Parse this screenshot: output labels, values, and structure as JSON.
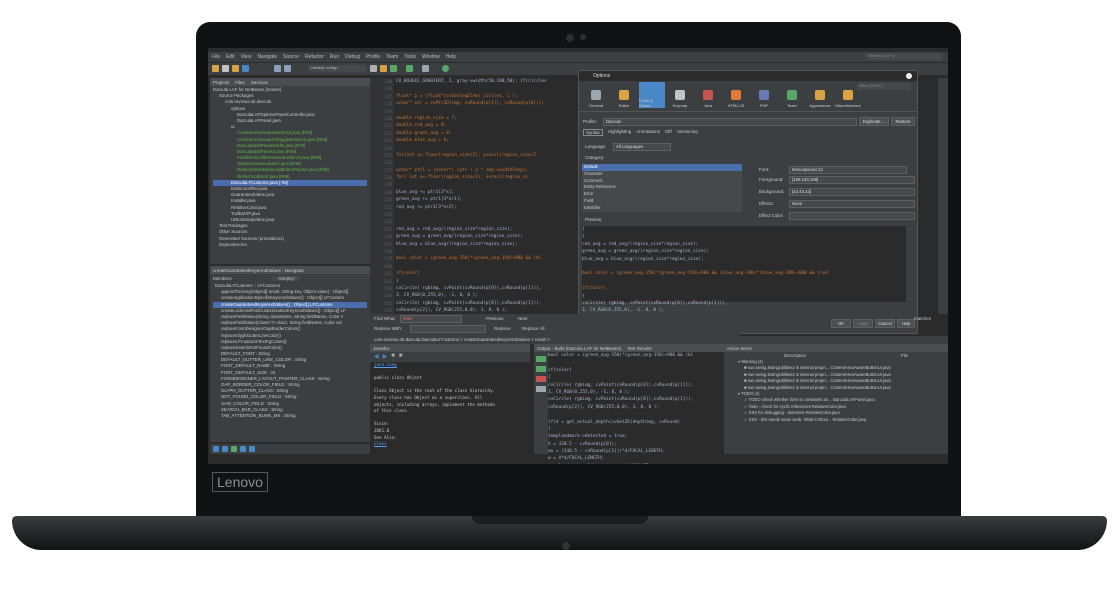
{
  "brand": "Lenovo",
  "menu": [
    "File",
    "Edit",
    "View",
    "Navigate",
    "Source",
    "Refactor",
    "Run",
    "Debug",
    "Profile",
    "Team",
    "Tools",
    "Window",
    "Help"
  ],
  "search_placeholder": "Search (Ctrl+I)",
  "config": "<default config>",
  "project_tabs": [
    "Projects",
    "Files",
    "Services"
  ],
  "tree": [
    "Darcula LAF for NetBeans [master]",
    "Source Packages",
    "com.revivius.nb.darcula",
    "options",
    "DarculaLAFOptionsPanelController.java",
    "DarculaLAFPanel.java",
    "ui",
    "ContentAreaAwareButtonUI.java [R/M]",
    "ContentAreaAwareJToggleButtonUI.java [R/M]",
    "DarculaSplitPaneDivider.java [R/M]",
    "DarculaSplitPaneUI.java [R/M]",
    "InvisibleScrollbarAwareBorderUI.java [R/M]",
    "OptionsAwareLabelUI.java [R/M]",
    "ReducedInsetsDarculaButtonPainter.java [R/M]",
    "RetinaToolbarUI.java [R/M]",
    "DarculaLFCustoms.java [-/M]",
    "DarkIconFilter.java",
    "GuaranteedValue.java",
    "Installer.java",
    "RelativeColor.java",
    "ToolbarXP.java",
    "UIBootstrapValue.java",
    "Test Packages",
    "Other Sources",
    "Generated Sources (annotations)",
    "Dependencies"
  ],
  "navigator_title": "createGuaranteedKeysAndValues - Navigator",
  "navigator_members": "Members",
  "navigator_filter": "<empty>",
  "navigator_items": [
    "DarculaLFCustoms :: LFCustoms",
    "appendToArray(Object[] result, String key, Object value) : Object[]",
    "createApplicationSpecificKeysAndValues() : Object[] LFCustom",
    "createGuaranteedKeysAndValues() : Object[] LFCustoms",
    "createLookAndFeelCustomizationKeysAndValues() : Object[] LF",
    "replaceFieldValue(String className, String fieldName, Color v",
    "replaceFieldValue(Class<?> clazz, String fieldName, Color val",
    "replaceFormDesignerGapBorderColors()",
    "replaceGlyphGutterLineColor()",
    "replaceLFCustomsTextFgColors()",
    "replaceSearchNotFoundColor()",
    "DEFAULT_FONT : String",
    "DEFAULT_GUTTER_LINE_COLOR : String",
    "FONT_DEFAULT_NAME : String",
    "FONT_DEFAULT_SIZE : int",
    "FORMDESIGNER_LAYOUT_PAINTER_CLASS : String",
    "GAP_BORDER_COLOR_FIELD : String",
    "GLYPH_GUTTER_CLASS : String",
    "NOT_FOUND_COLOR_FIELD : String",
    "SAW_COLOR_FIELD : String",
    "SEARCH_BAR_CLASS : String",
    "TAB_ATTENTION_BLINK_MS : String"
  ],
  "gutter_lines": [
    "118",
    "116",
    "117",
    "118",
    "119",
    "120",
    "121",
    "122",
    "123",
    "124",
    "125",
    "126",
    "127",
    "128",
    "129",
    "130",
    "131",
    "132",
    "133",
    "134",
    "135",
    "136",
    "137",
    "138",
    "139",
    "140",
    "141",
    "142",
    "143",
    "144",
    "145",
    "146"
  ],
  "code_lines": [
    "    CV_BOOGIE_GRADIENT, 2, gray->width/50,100,50); if(circles",
    "",
    "  float* p = (float*)cvGetSeqElem( circles, i );",
    "  uchar* ptr  = cvPtr2D(img, cvRound(p[1]), cvRound(p[0]));",
    "",
    "  double region_size = 7;",
    "  double red_avg = 0;",
    "  double green_avg = 0;",
    "  double blue_avg = 0;",
    "",
    "  for(int y=-floor(region_size/2); y<ceil(region_size/2",
    "",
    "    uchar* ptr1 = (uchar*) (ptr + y * img->widthStep);",
    "    for( int x=-floor(region_size/2); x<ceil(region_si",
    "",
    "      blue_avg += ptr1[3*x];",
    "      green_avg += ptr1[3*x+1];",
    "      red_avg += ptr1[3*x+2];",
    "",
    "",
    "  red_avg = red_avg/(region_size*region_size);",
    "  green_avg = green_avg/(region_size*region_size);",
    "  blue_avg = blue_avg/(region_size*region_size);",
    "",
    "  bool color = (green_avg-150)*(green_avg-150)<900 && (bl",
    "",
    "  if(color)",
    "  {",
    "  cvCircle( rgbimg, cvPoint(cvRound(p[0]),cvRound(p[1])),",
    "      3, CV_RGB(0,255,0), -1, 8, 0 );",
    "  cvCircle( rgbimg, cvPoint(cvRound(p[0]),cvRound(p[1])),",
    "      cvRound(p[2]), CV_RGB(255,0,0), 3, 8, 0 );"
  ],
  "options": {
    "title": "Options",
    "filter": "Filter (Ctrl+F)",
    "tabs": [
      "General",
      "Editor",
      "Fonts & Colors",
      "Keymap",
      "Java",
      "HTML/JS",
      "PHP",
      "Team",
      "Appearance",
      "Miscellaneous"
    ],
    "profile_label": "Profile:",
    "profile_value": "Darcula",
    "duplicate": "Duplicate ...",
    "restore": "Restore",
    "subtabs": [
      "Syntax",
      "Highlighting",
      "Annotations",
      "Diff",
      "Versioning"
    ],
    "language_label": "Language:",
    "language_value": "All Languages",
    "category_label": "Category:",
    "categories": [
      "Default",
      "Character",
      "Comment",
      "Entity Reference",
      "Error",
      "Field",
      "Identifier"
    ],
    "font_label": "Font:",
    "font_value": "Monospaced 13",
    "fg_label": "Foreground:",
    "fg_value": "[169,183,198]",
    "bg_label": "Background:",
    "bg_value": "[43,43,43]",
    "effects_label": "Effects:",
    "effects_value": "None",
    "effect_color_label": "Effect Color:",
    "preview_label": "Preview:",
    "preview_lines": [
      "    }",
      "}",
      "red_avg = red_avg/(region_size*region_size);",
      "green_avg = green_avg/(region_size*region_size);",
      "blue_avg = blue_avg/(region_size*region_size);",
      "",
      "bool color = (green_avg-150)*(green_avg-150)<900 && (blue_avg-100)*(blue_avg-100)<600 && (red",
      "",
      "if(color)",
      "{",
      "cvCircle( rgbimg, cvPoint(cvRound(p[0]),cvRound(p[1])),",
      "    3, CV_RGB(0,255,0), -1, 8, 0 );",
      "  cvCircle( rgbimg, cvPoint(cvRound(p[0]),cvRound(p[1])),"
    ],
    "export": "Export...",
    "import": "Import...",
    "ok": "OK",
    "apply": "Apply",
    "cancel": "Cancel",
    "help": "Help"
  },
  "find": {
    "find_label": "Find What:",
    "find_value": "5008",
    "replace_label": "Replace With:",
    "previous": "Previous",
    "next": "Next",
    "replace": "Replace",
    "replace_all": "Replace All",
    "matches": "matches"
  },
  "breadcrumb": "com.revivius.nb.darcula.DarculaLFCustoms  >  createGuaranteedKeysAndValues  >  result  >",
  "javadoc": {
    "title": "Javadoc",
    "lines": [
      "java.lang",
      "",
      "public class Object",
      "",
      "Class Object is the root of the class hierarchy.",
      "Every class has Object as a superclass. All",
      "objects, including arrays, implement the methods",
      "of this class.",
      "",
      "Since:",
      "  JDK1.0",
      "See Also:",
      "  Class"
    ]
  },
  "output": {
    "title": "Output - Build (Darcula LAF for NetBeans)",
    "test_title": "Test Results",
    "lines": [
      "bool color = (green_avg-150)*(green_avg-150)<900 && (bl",
      "",
      "if(color)",
      "{",
      "cvCircle( rgbimg, cvPoint(cvRound(p[0]),cvRound(p[1])),",
      "    3, CV_RGB(0,255,0), -1, 8, 0 );",
      "  cvCircle( rgbimg, cvPoint(cvRound(p[0]),cvRound(p[1])),",
      "      cvRound(p[2]), CV_RGB(255,0,0), 3, 8, 0 );",
      "",
      "  if(d = get_actual_depth(cvGet2D(depthimg, cvRound(",
      "  {",
      "    templandmark->detected = true;",
      "    X   = 320.5 - cvRound(p[0]);",
      "    mu  = (240.5 - cvRound(p[1]))*d/FOCAL_LENGTH;",
      "    w  = X*d/FOCAL_LENGTH;",
      "    templandmark->alpha = atan(w/d)*180/PI;"
    ]
  },
  "action_items": {
    "title": "Action Items",
    "col_description": "Description",
    "col_file": "File",
    "warning_header": "Warning (4)",
    "warnings": [
      "sun.swing.SwingUtilities2 is internal propri...  ContentAreaAwareButtonUI.java",
      "sun.swing.SwingUtilities2 is internal propri...  ContentAreaAwareButtonUI.java",
      "sun.swing.SwingUtilities2 is internal propri...  ContentAreaAwareButtonUI.java",
      "sun.swing.SwingUtilities2 is internal propri...  ContentAreaAwareButtonUI.java"
    ],
    "todo_header": "TODO (4)",
    "todos": [
      "TODO check whether form is consistent an...  DarculaLAFPanel.java",
      "Todo - check for cyclic references  RelativeColor.java",
      "XXX for debugging - deleteme  RelativeColor.java",
      "XXX - this needs some work. What it shoul...  RelativeColor.java"
    ]
  },
  "colors": {
    "bezel": "#111214",
    "ide_bg": "#2b2b2b",
    "panel": "#3c3f41",
    "selection": "#4b6eaf",
    "active_tab": "#4a88c7",
    "green_file": "#62b543",
    "keyword": "#cc7832",
    "number": "#6897bb",
    "string": "#6a8759"
  }
}
